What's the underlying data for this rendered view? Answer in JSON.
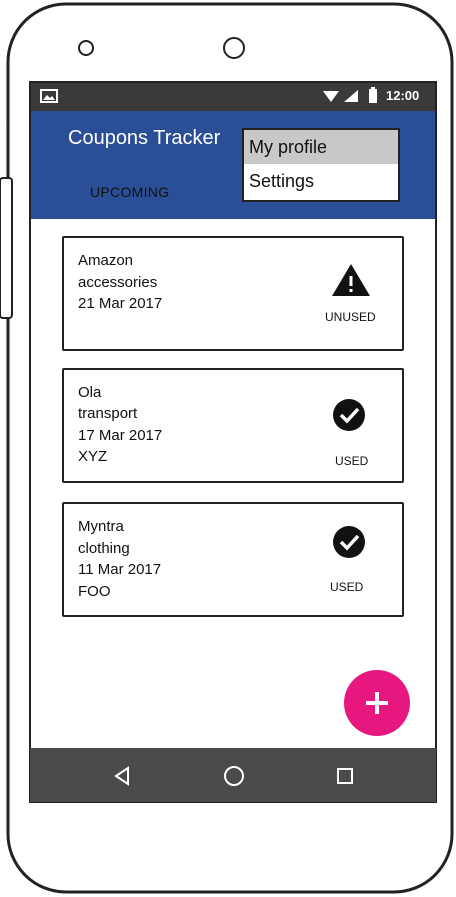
{
  "status_bar": {
    "time": "12:00"
  },
  "app_bar": {
    "title": "Coupons Tracker",
    "tab_label": "UPCOMING"
  },
  "menu": {
    "items": [
      "My profile",
      "Settings"
    ],
    "selected_index": 0
  },
  "coupons": [
    {
      "lines": [
        "Amazon",
        "accessories",
        "21 Mar 2017"
      ],
      "status": "UNUSED",
      "icon": "warning-icon"
    },
    {
      "lines": [
        "Ola",
        "transport",
        "17 Mar 2017",
        "XYZ"
      ],
      "status": "USED",
      "icon": "check-circle-icon"
    },
    {
      "lines": [
        "Myntra",
        "clothing",
        "11 Mar 2017",
        "FOO"
      ],
      "status": "USED",
      "icon": "check-circle-icon"
    }
  ],
  "fab": {
    "icon": "plus-icon",
    "color": "#e6177f"
  },
  "nav_bar": {
    "icons": [
      "back-icon",
      "home-icon",
      "recents-icon"
    ]
  },
  "colors": {
    "app_bar": "#2b4f96",
    "status_bar": "#3a3a3a",
    "nav_bar": "#4a4a4a",
    "fab": "#e6177f"
  }
}
